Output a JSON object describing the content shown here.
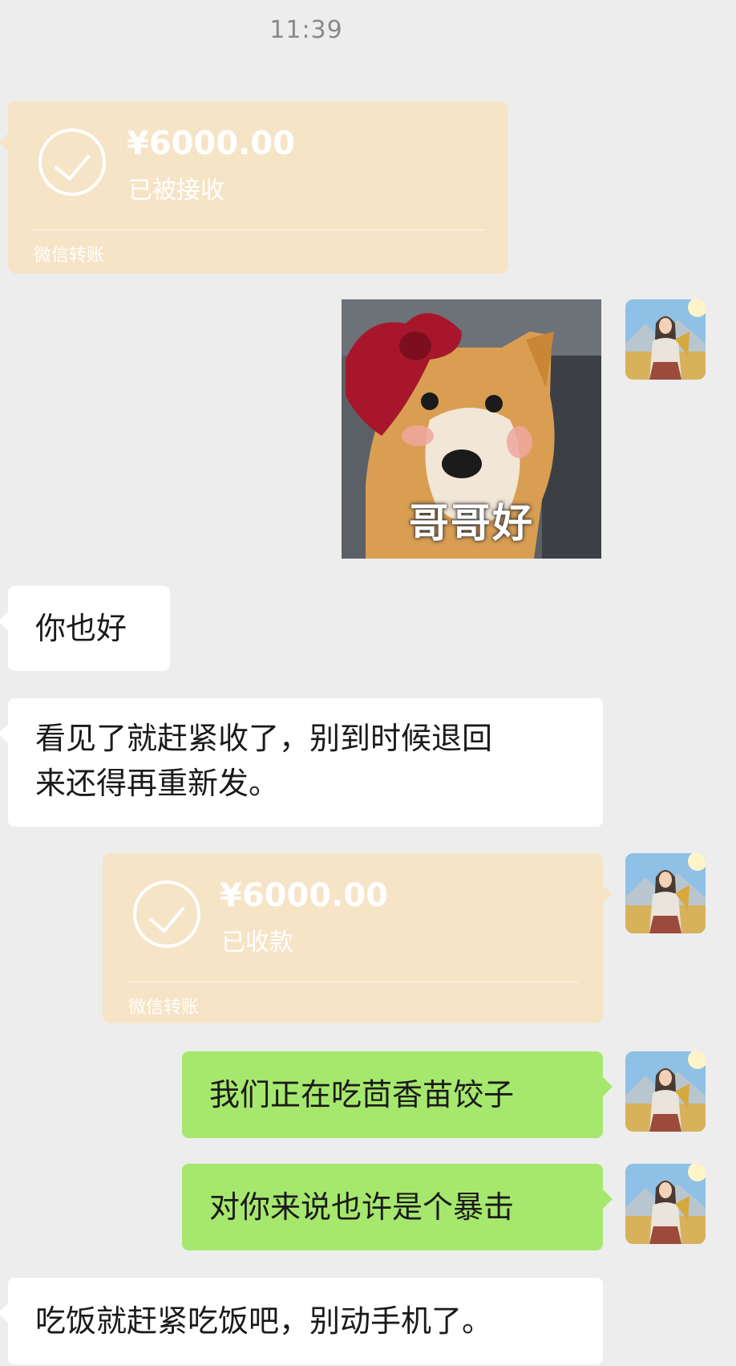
{
  "header": {
    "time": "11:39"
  },
  "messages": {
    "transfer_in": {
      "amount": "¥6000.00",
      "status": "已被接收",
      "footer": "微信转账"
    },
    "sticker": {
      "caption": "哥哥好",
      "description_icon": "dog-with-red-bow-sticker"
    },
    "reply_1": {
      "text": "你也好"
    },
    "reply_2": {
      "line1": "看见了就赶紧收了，别到时候退回",
      "line2": "来还得再重新发。"
    },
    "transfer_out": {
      "amount": "¥6000.00",
      "status": "已收款",
      "footer": "微信转账"
    },
    "sent_1": {
      "text": "我们正在吃茴香苗饺子"
    },
    "sent_2": {
      "text": "对你来说也许是个暴击"
    },
    "reply_3": {
      "text": "吃饭就赶紧吃饭吧，别动手机了。"
    }
  },
  "colors": {
    "background": "#ededed",
    "transfer_card": "#f6e4c6",
    "sent_bubble": "#a6e86d",
    "received_bubble": "#ffffff"
  }
}
